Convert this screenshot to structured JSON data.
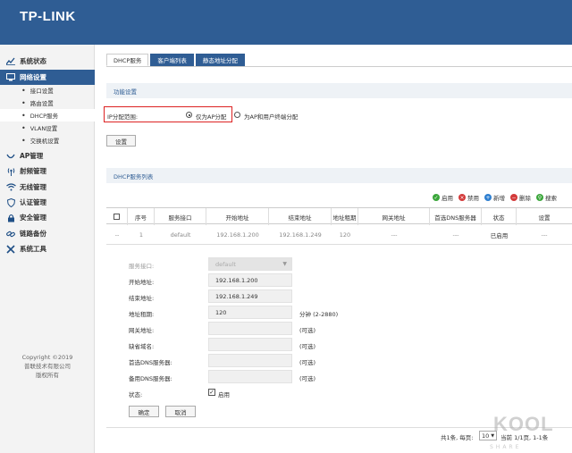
{
  "brand": "TP-LINK",
  "sidebar": {
    "items": [
      {
        "label": "系统状态",
        "icon": "chart-line-icon"
      },
      {
        "label": "网络设置",
        "icon": "network-icon",
        "active": true
      },
      {
        "label": "AP管理",
        "icon": "ap-icon"
      },
      {
        "label": "射频管理",
        "icon": "radio-wave-icon"
      },
      {
        "label": "无线管理",
        "icon": "wifi-icon"
      },
      {
        "label": "认证管理",
        "icon": "shield-icon"
      },
      {
        "label": "安全管理",
        "icon": "lock-icon"
      },
      {
        "label": "链路备份",
        "icon": "link-icon"
      },
      {
        "label": "系统工具",
        "icon": "tools-icon"
      }
    ],
    "sub_items": [
      "接口设置",
      "路由设置",
      "DHCP服务",
      "VLAN设置",
      "交换机设置"
    ],
    "copyright": [
      "Copyright ©2019",
      "普联技术有限公司",
      "版权所有"
    ]
  },
  "tabs": [
    "DHCP服务",
    "客户端列表",
    "静态地址分配"
  ],
  "function_settings": {
    "title": "功能设置",
    "range_label": "IP分配范围:",
    "option_ap_only": "仅为AP分配",
    "option_ap_and_users": "为AP和用户终端分配",
    "selected": "仅为AP分配",
    "set_button": "设置"
  },
  "dhcp_list": {
    "title": "DHCP服务列表",
    "actions": [
      {
        "label": "启用",
        "color": "#3aa63a",
        "icon": "check-icon"
      },
      {
        "label": "禁用",
        "color": "#d33a3a",
        "icon": "ban-icon"
      },
      {
        "label": "新增",
        "color": "#2f7fd0",
        "icon": "plus-icon"
      },
      {
        "label": "删除",
        "color": "#d33a3a",
        "icon": "minus-icon"
      },
      {
        "label": "搜索",
        "color": "#3aa63a",
        "icon": "search-icon"
      }
    ],
    "columns": [
      "序号",
      "服务接口",
      "开始地址",
      "结束地址",
      "地址租期",
      "网关地址",
      "首选DNS服务器",
      "状态",
      "设置"
    ],
    "rows": [
      [
        "--",
        "1",
        "default",
        "192.168.1.200",
        "192.168.1.249",
        "120",
        "---",
        "---",
        "已启用",
        "---"
      ]
    ]
  },
  "edit_form": {
    "interface_label": "服务接口:",
    "interface_value": "default",
    "start_label": "开始地址:",
    "start_value": "192.168.1.200",
    "end_label": "结束地址:",
    "end_value": "192.168.1.249",
    "lease_label": "地址租期:",
    "lease_value": "120",
    "lease_note": "分钟 (2-2880)",
    "gateway_label": "网关地址:",
    "gateway_note": "(可选)",
    "domain_label": "缺省域名:",
    "domain_note": "(可选)",
    "dns1_label": "首选DNS服务器:",
    "dns1_note": "(可选)",
    "dns2_label": "备用DNS服务器:",
    "dns2_note": "(可选)",
    "status_label": "状态:",
    "status_enable": "启用",
    "ok_button": "确定",
    "cancel_button": "取消"
  },
  "pager": {
    "summary": "共1条, 每页:",
    "per_page": "10",
    "page_info": "当前 1/1页, 1-1条"
  },
  "watermark": {
    "main": "KOOL",
    "sub": "SHARE"
  }
}
